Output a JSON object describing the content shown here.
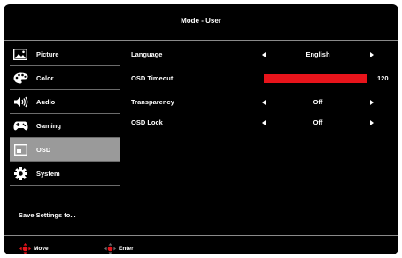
{
  "header": {
    "title": "Mode - User"
  },
  "sidebar": {
    "items": [
      {
        "label": "Picture",
        "icon": "picture-icon"
      },
      {
        "label": "Color",
        "icon": "color-palette-icon"
      },
      {
        "label": "Audio",
        "icon": "speaker-icon"
      },
      {
        "label": "Gaming",
        "icon": "gamepad-icon"
      },
      {
        "label": "OSD",
        "icon": "osd-window-icon",
        "selected": true
      },
      {
        "label": "System",
        "icon": "gear-icon"
      }
    ],
    "save_label": "Save Settings to..."
  },
  "settings": {
    "language": {
      "label": "Language",
      "value": "English"
    },
    "osd_timeout": {
      "label": "OSD Timeout",
      "value": "120",
      "fill_fraction": 1.0
    },
    "transparency": {
      "label": "Transparency",
      "value": "Off"
    },
    "osd_lock": {
      "label": "OSD Lock",
      "value": "Off"
    }
  },
  "footer": {
    "move_label": "Move",
    "enter_label": "Enter"
  },
  "colors": {
    "accent": "#e8141b",
    "selected_bg": "#9a9a9a",
    "background": "#000000"
  }
}
